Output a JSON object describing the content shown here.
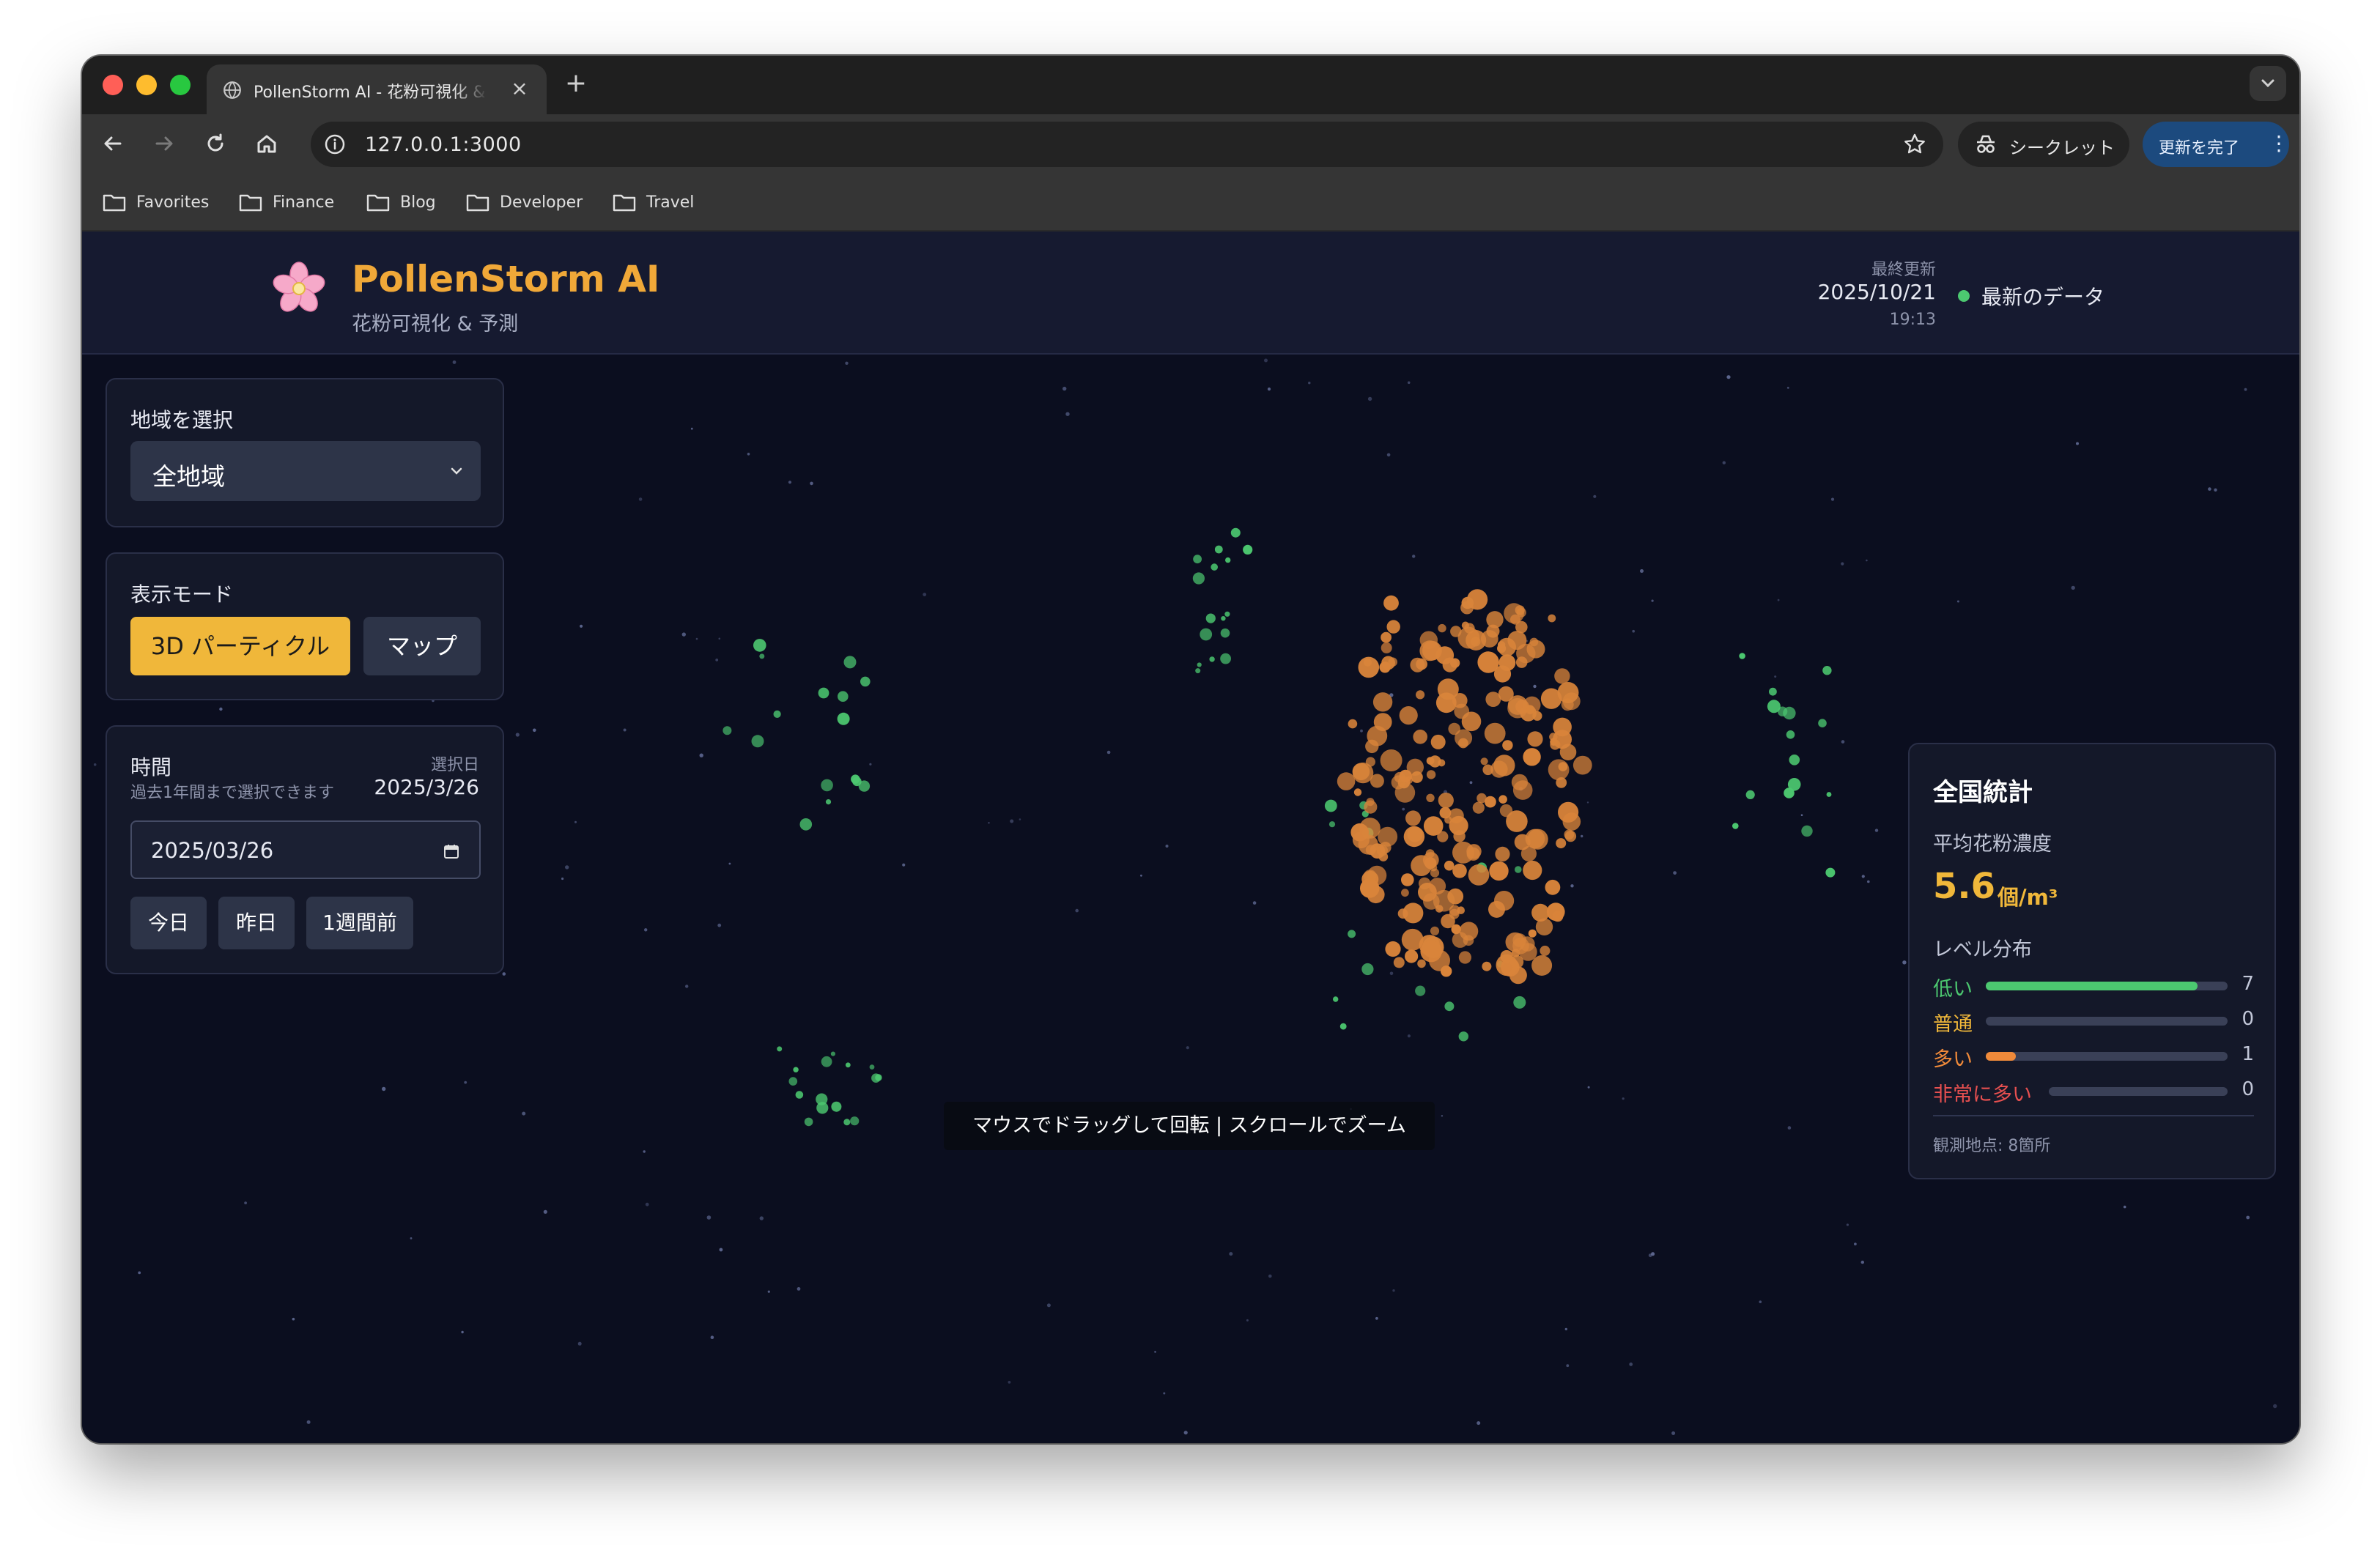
{
  "browser": {
    "tab_title": "PollenStorm AI - 花粉可視化 & 予測",
    "url": "127.0.0.1:3000",
    "incognito_label": "シークレット",
    "update_label": "更新を完了",
    "bookmarks": [
      "Favorites",
      "Finance",
      "Blog",
      "Developer",
      "Travel"
    ]
  },
  "header": {
    "title": "PollenStorm AI",
    "subtitle": "花粉可視化 & 予測",
    "updated_label": "最終更新",
    "updated_date": "2025/10/21",
    "updated_time": "19:13",
    "status_text": "最新のデータ",
    "status_color": "#4cc870"
  },
  "controls": {
    "region": {
      "label": "地域を選択",
      "value": "全地域"
    },
    "mode": {
      "label": "表示モード",
      "options": [
        "3D パーティクル",
        "マップ"
      ],
      "active": "3D パーティクル"
    },
    "time": {
      "label": "時間",
      "sublabel": "過去1年間まで選択できます",
      "selected_label": "選択日",
      "selected_value": "2025/3/26",
      "input_value": "2025/03/26",
      "quick": [
        "今日",
        "昨日",
        "1週間前"
      ]
    }
  },
  "viewport": {
    "hint": "マウスでドラッグして回転 | スクロールでズーム"
  },
  "stats": {
    "title": "全国統計",
    "avg_label": "平均花粉濃度",
    "avg_value": "5.6",
    "avg_unit": "個/m³",
    "distribution_label": "レベル分布",
    "levels": [
      {
        "label": "低い",
        "count": 7,
        "color": "#4cc870"
      },
      {
        "label": "普通",
        "count": 0,
        "color": "#f0b73a"
      },
      {
        "label": "多い",
        "count": 1,
        "color": "#f08a3a"
      },
      {
        "label": "非常に多い",
        "count": 0,
        "color": "#e85050"
      }
    ],
    "footer": "観測地点: 8箇所"
  },
  "colors": {
    "accent": "#f0b73a",
    "low": "#4cc870",
    "high": "#d9843a",
    "background": "#0b0e1f"
  }
}
